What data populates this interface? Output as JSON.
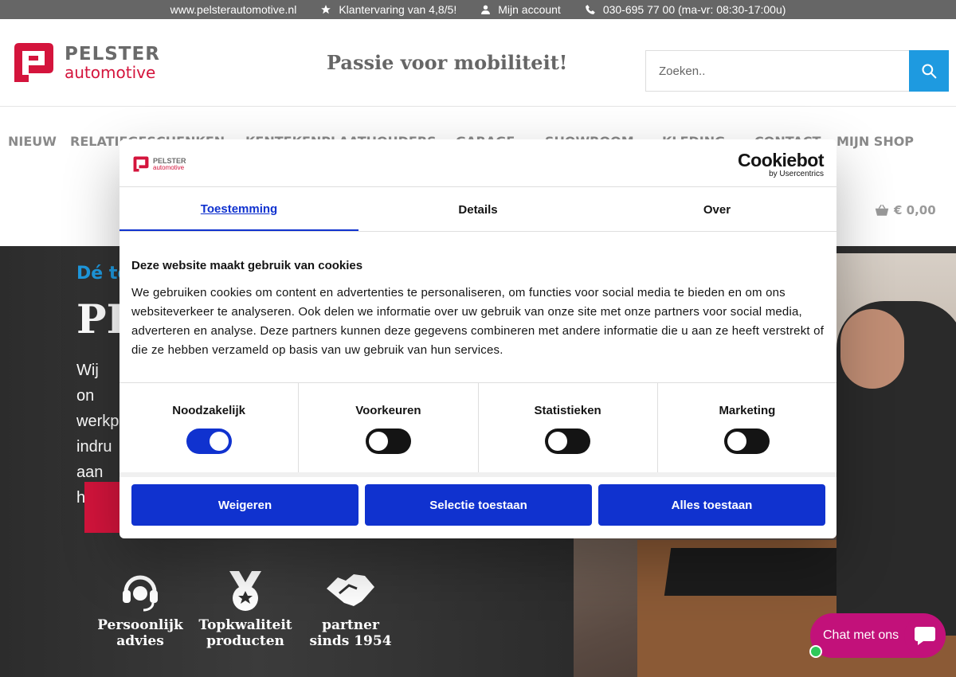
{
  "topbar": {
    "website": "www.pelsterautomotive.nl",
    "rating": "Klantervaring van 4,8/5!",
    "account": "Mijn account",
    "phone": "030-695 77 00 (ma-vr: 08:30-17:00u)"
  },
  "header": {
    "logo_line1": "PELSTER",
    "logo_line2": "automotive",
    "tagline": "Passie voor mobiliteit!",
    "search_placeholder": "Zoeken.."
  },
  "nav": {
    "items": [
      "NIEUW",
      "RELATIEGESCHENKEN",
      "KENTEKENPLAATHOUDERS",
      "GARAGE",
      "SHOWROOM",
      "KLEDING",
      "CONTACT",
      "MIJN SHOP"
    ],
    "cart_total": "€ 0,00"
  },
  "hero": {
    "subtitle": "Dé to",
    "title": "PE",
    "text": "Wij on werkp indru aan h",
    "features": [
      {
        "line1": "Persoonlijk",
        "line2": "advies",
        "icon": "headset-icon"
      },
      {
        "line1": "Topkwaliteit",
        "line2": "producten",
        "icon": "medal-icon"
      },
      {
        "line1": "partner",
        "line2": "sinds 1954",
        "icon": "handshake-icon"
      }
    ]
  },
  "cookiebot": {
    "logo_line1": "PELSTER",
    "logo_line2": "automotive",
    "brand": "Cookiebot",
    "brand_sub": "by Usercentrics",
    "tabs": [
      "Toestemming",
      "Details",
      "Over"
    ],
    "heading": "Deze website maakt gebruik van cookies",
    "body": "We gebruiken cookies om content en advertenties te personaliseren, om functies voor social media te bieden en om ons websiteverkeer te analyseren. Ook delen we informatie over uw gebruik van onze site met onze partners voor social media, adverteren en analyse. Deze partners kunnen deze gegevens combineren met andere informatie die u aan ze heeft verstrekt of die ze hebben verzameld op basis van uw gebruik van hun services.",
    "categories": [
      {
        "label": "Noodzakelijk",
        "on": true
      },
      {
        "label": "Voorkeuren",
        "on": false
      },
      {
        "label": "Statistieken",
        "on": false
      },
      {
        "label": "Marketing",
        "on": false
      }
    ],
    "buttons": {
      "deny": "Weigeren",
      "selection": "Selectie toestaan",
      "all": "Alles toestaan"
    }
  },
  "chat": {
    "label": "Chat met ons"
  },
  "colors": {
    "brand_red": "#d4143c",
    "accent_blue": "#1e9ae0",
    "cookie_blue": "#1032cf",
    "chat_pink": "#c2117a"
  }
}
